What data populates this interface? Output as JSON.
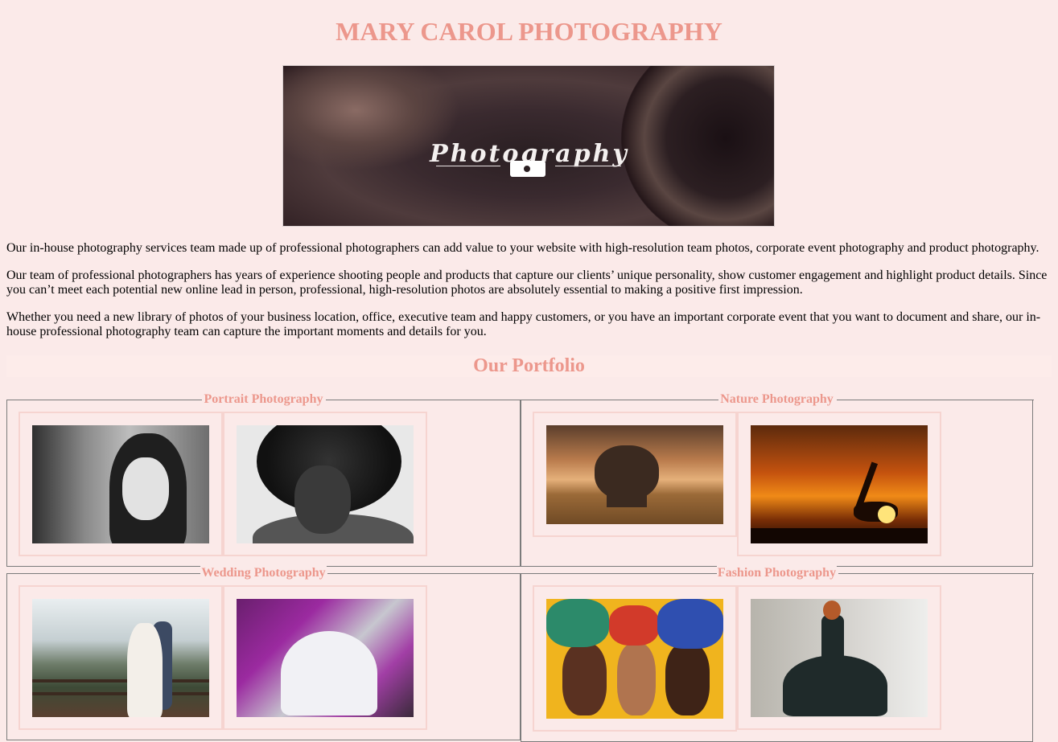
{
  "header": {
    "title": "MARY CAROL PHOTOGRAPHY"
  },
  "banner": {
    "caption": "Photography",
    "icon": "camera-icon"
  },
  "intro": {
    "p1": "Our in-house photography services team made up of professional photographers can add value to your website with high-resolution team photos, corporate event photography and product photography.",
    "p2": "Our team of professional photographers has years of experience shooting people and products that capture our clients’ unique personality, show customer engagement and highlight product details. Since you can’t meet each potential new online lead in person, professional, high-resolution photos are absolutely essential to making a positive first impression.",
    "p3": "Whether you need a new library of photos of your business location, office, executive team and happy customers, or you have an important corporate event that you want to document and share, our in-house professional photography team can capture the important moments and details for you."
  },
  "portfolio": {
    "title": "Our Portfolio",
    "categories": [
      {
        "legend": "Portrait Photography"
      },
      {
        "legend": "Nature Photography"
      },
      {
        "legend": "Wedding Photography"
      },
      {
        "legend": "Fashion Photography"
      }
    ]
  },
  "colors": {
    "accent": "#ec978c",
    "background": "#fbeae9",
    "frame": "#f6d4d0"
  }
}
